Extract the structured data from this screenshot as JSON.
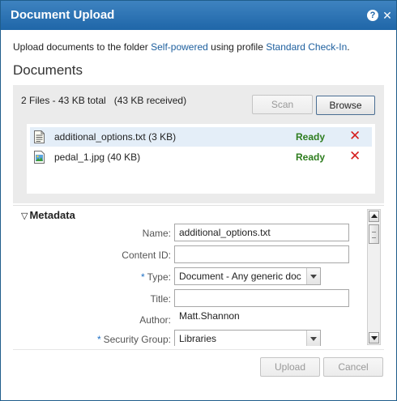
{
  "dialog": {
    "title": "Document Upload",
    "help_icon": "question-mark-icon",
    "close_icon": "close-icon",
    "title_bar_color": "#2a70b0"
  },
  "intro": {
    "prefix": "Upload documents to the folder ",
    "folder_link": "Self-powered",
    "middle": " using profile ",
    "profile_link": "Standard Check-In",
    "suffix": "."
  },
  "documents": {
    "heading": "Documents",
    "summary": "2 Files - 43 KB total   (43 KB received)",
    "scan_label": "Scan",
    "browse_label": "Browse",
    "files": [
      {
        "name": "additional_options.txt (3 KB)",
        "status": "Ready",
        "icon": "text-file-icon",
        "remove": "✕"
      },
      {
        "name": "pedal_1.jpg (40 KB)",
        "status": "Ready",
        "icon": "image-file-icon",
        "remove": "✕"
      }
    ],
    "status_color": "#2e7d1f",
    "remove_color": "#d51f1f"
  },
  "metadata": {
    "heading": "Metadata",
    "collapse_glyph": "▽",
    "fields": {
      "name": {
        "label": "Name:",
        "value": "additional_options.txt",
        "placeholder": ""
      },
      "content_id": {
        "label": "Content ID:",
        "value": "",
        "placeholder": ""
      },
      "type": {
        "label": "Type:",
        "value": "Document - Any generic doc",
        "required_mark": "*"
      },
      "title": {
        "label": "Title:",
        "value": "",
        "placeholder": ""
      },
      "author": {
        "label": "Author:",
        "value": "Matt.Shannon"
      },
      "security_group": {
        "label": "Security Group:",
        "value": "Libraries",
        "required_mark": "*"
      }
    }
  },
  "footer": {
    "upload_label": "Upload",
    "cancel_label": "Cancel"
  }
}
